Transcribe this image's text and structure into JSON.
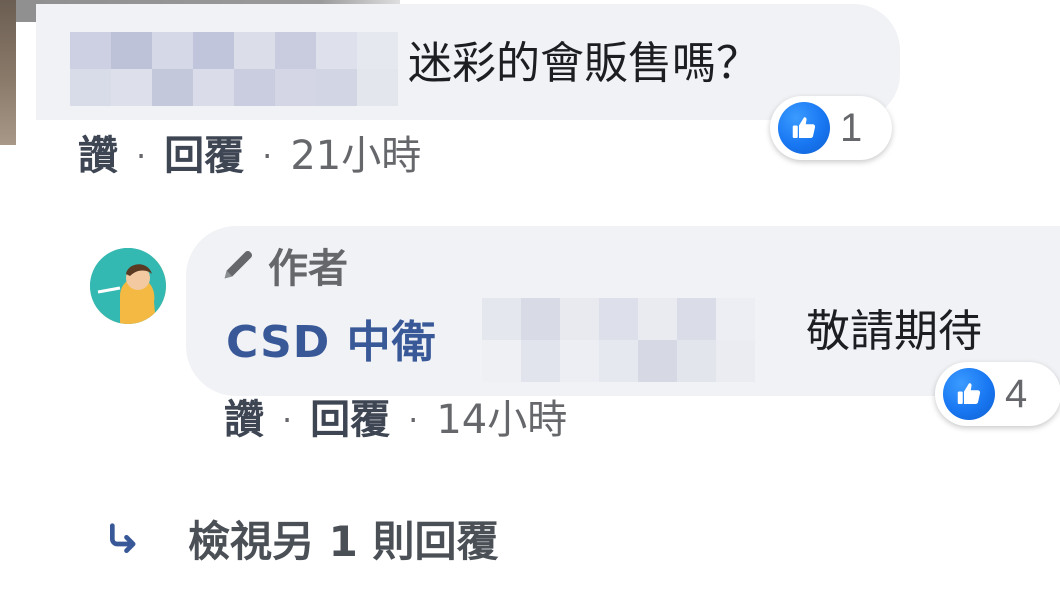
{
  "comments": [
    {
      "text": "迷彩的會販售嗎？",
      "like_count": "1",
      "actions": {
        "like": "讚",
        "reply": "回覆",
        "time": "21小時"
      }
    }
  ],
  "reply": {
    "author_badge": "作者",
    "author_name": "CSD 中衛",
    "text": "敬請期待",
    "like_count": "4",
    "actions": {
      "like": "讚",
      "reply": "回覆",
      "time": "14小時"
    }
  },
  "view_more": {
    "label": "檢視另 1 則回覆"
  },
  "icons": {
    "reaction": "like-thumb-icon",
    "badge": "pencil-icon",
    "view_more": "reply-arrow-icon"
  },
  "colors": {
    "like_blue": "#1877f2",
    "author_name": "#385898",
    "bubble_bg": "#f0f2f5",
    "meta_gray": "#65676b"
  }
}
